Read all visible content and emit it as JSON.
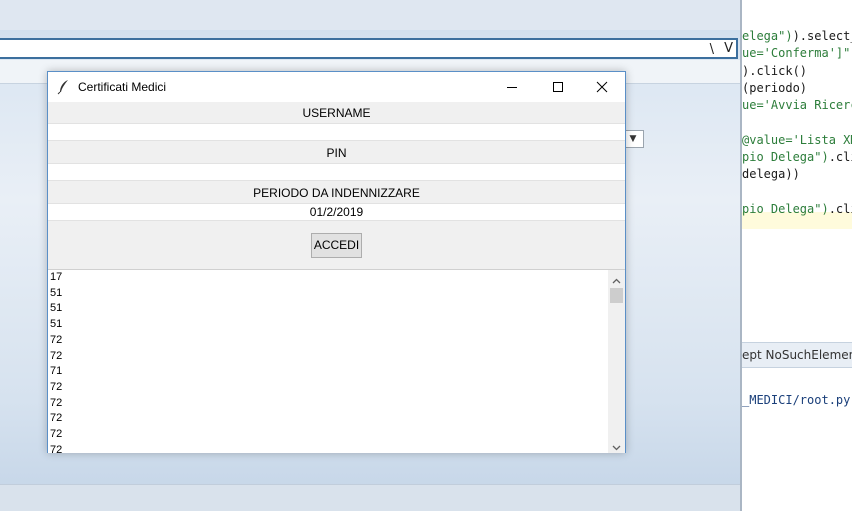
{
  "background": {
    "url_text": "\\",
    "url_tail": "V",
    "editor": {
      "lines": [
        {
          "pre": "",
          "str": "elega\")",
          "post": ").select_b"
        },
        {
          "pre": "",
          "str": "ue='Conferma']\")",
          "post": ""
        },
        {
          "pre": "",
          "str": "",
          "post": ").click()"
        },
        {
          "pre": "",
          "str": "",
          "post": "(periodo)"
        },
        {
          "pre": "",
          "str": "ue='Avvia Ricerc",
          "post": ""
        },
        {
          "pre": "",
          "str": "",
          "post": ""
        },
        {
          "pre": "",
          "str": "@value='Lista XM",
          "post": ""
        },
        {
          "pre": "",
          "str": "pio Delega\")",
          "post": ".clic"
        },
        {
          "pre": "",
          "str": "",
          "post": "delega))"
        },
        {
          "pre": "",
          "str": "",
          "post": ""
        },
        {
          "pre": "",
          "str": "pio Delega\")",
          "post": ".clic"
        }
      ],
      "panel_text": "ept NoSuchElementE",
      "path_text": "_MEDICI/root.py"
    }
  },
  "window": {
    "title": "Certificati Medici",
    "username_label": "USERNAME",
    "username_value": "",
    "pin_label": "PIN",
    "pin_value": "",
    "periodo_label": "PERIODO DA INDENNIZZARE",
    "periodo_value": "01/2/2019",
    "accedi_label": "ACCEDI",
    "list_items": [
      "17",
      "51",
      "51",
      "51",
      "72",
      "72",
      "71",
      "72",
      "72",
      "72",
      "72",
      "72"
    ]
  },
  "colors": {
    "window_border": "#5a8fc7",
    "code_string": "#2c7d3a",
    "path_text": "#1a3f7a"
  },
  "icons": {
    "app": "feather-icon",
    "minimize": "minimize-icon",
    "maximize": "maximize-icon",
    "close": "close-icon",
    "scroll_up": "chevron-up-icon",
    "scroll_down": "chevron-down-icon"
  }
}
